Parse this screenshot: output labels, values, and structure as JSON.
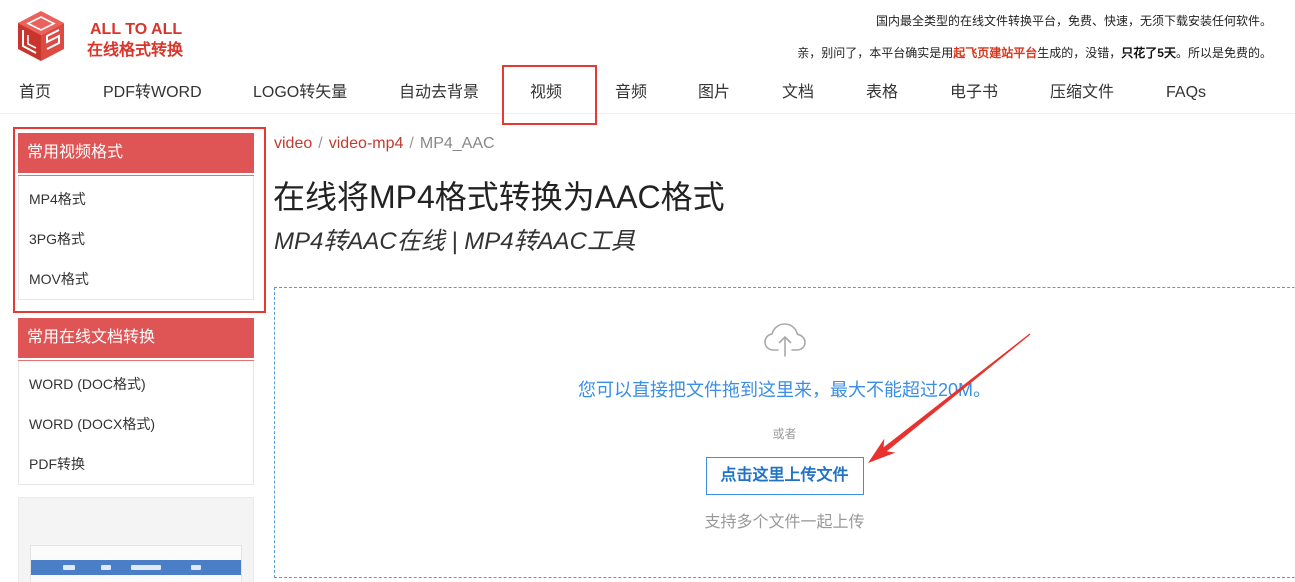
{
  "brand": {
    "name_en": "ALL TO ALL",
    "name_cn": "在线格式转换",
    "logo_icon": "cube-logo-icon"
  },
  "header": {
    "tagline": "国内最全类型的在线文件转换平台，免费、快速，无须下载安装任何软件。",
    "notice": {
      "prefix": "亲，别问了，本平台确实是用",
      "link": "起飞页建站平台",
      "middle": "生成的，没错，",
      "bold": "只花了5天",
      "suffix": "。所以是免费的。"
    }
  },
  "nav": {
    "active_index": 4,
    "items": [
      {
        "label": "首页"
      },
      {
        "label": "PDF转WORD"
      },
      {
        "label": "LOGO转矢量"
      },
      {
        "label": "自动去背景"
      },
      {
        "label": "视频"
      },
      {
        "label": "音频"
      },
      {
        "label": "图片"
      },
      {
        "label": "文档"
      },
      {
        "label": "表格"
      },
      {
        "label": "电子书"
      },
      {
        "label": "压缩文件"
      },
      {
        "label": "FAQs"
      }
    ]
  },
  "sidebar": {
    "panels": [
      {
        "title": "常用视频格式",
        "items": [
          "MP4格式",
          "3PG格式",
          "MOV格式"
        ]
      },
      {
        "title": "常用在线文档转换",
        "items": [
          "WORD (DOC格式)",
          "WORD (DOCX格式)",
          "PDF转换"
        ]
      }
    ]
  },
  "breadcrumb": {
    "separator": "/",
    "items": [
      "video",
      "video-mp4",
      "MP4_AAC"
    ]
  },
  "page": {
    "title": "在线将MP4格式转换为AAC格式",
    "subtitle": "MP4转AAC在线 | MP4转AAC工具"
  },
  "upload": {
    "icon": "cloud-upload-icon",
    "drop_hint": "您可以直接把文件拖到这里来，最大不能超过20M。",
    "or_text": "或者",
    "button_label": "点击这里上传文件",
    "multi_hint": "支持多个文件一起上传"
  },
  "colors": {
    "brand_red": "#d9352b",
    "panel_header_red": "#df5454",
    "annotation_red": "#e53935",
    "breadcrumb_red": "#c23b2f",
    "accent_blue": "#3a8ee6",
    "button_text_blue": "#1f72c6"
  }
}
